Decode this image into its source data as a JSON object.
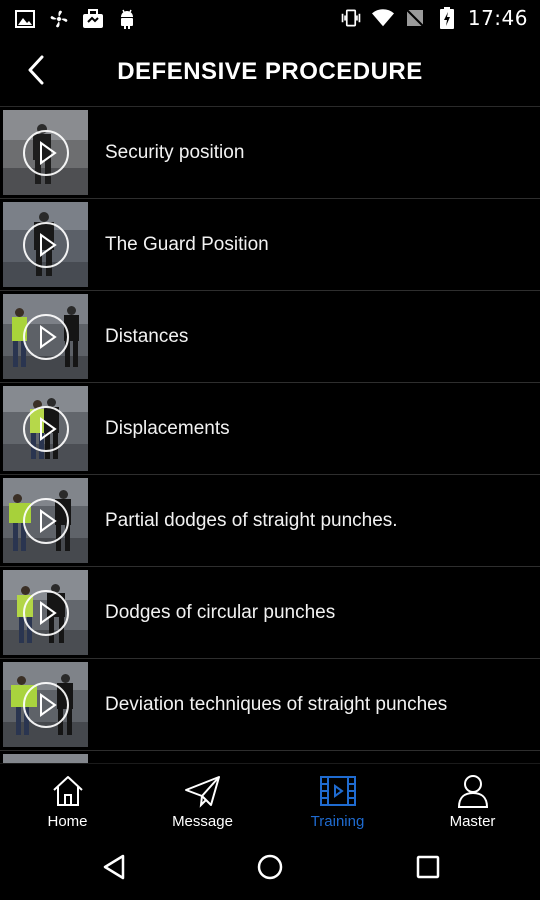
{
  "status_bar": {
    "time": "17:46",
    "left_icons": [
      "image-icon",
      "fan-icon",
      "briefcase-icon",
      "android-icon"
    ],
    "right_icons": [
      "vibrate-icon",
      "wifi-icon",
      "no-sim-icon",
      "battery-icon"
    ]
  },
  "header": {
    "title": "DEFENSIVE PROCEDURE",
    "back_icon": "chevron-left-icon"
  },
  "list": {
    "items": [
      {
        "label": "Security position"
      },
      {
        "label": "The Guard Position"
      },
      {
        "label": "Distances"
      },
      {
        "label": "Displacements"
      },
      {
        "label": "Partial dodges of straight punches."
      },
      {
        "label": "Dodges of circular punches"
      },
      {
        "label": "Deviation techniques of straight punches"
      }
    ]
  },
  "bottom_nav": {
    "items": [
      {
        "label": "Home",
        "icon": "house-icon"
      },
      {
        "label": "Message",
        "icon": "paper-plane-icon"
      },
      {
        "label": "Training",
        "icon": "film-icon",
        "active": true
      },
      {
        "label": "Master",
        "icon": "person-icon"
      }
    ]
  },
  "colors": {
    "background": "#000000",
    "active": "#1f6bd0",
    "divider": "#2e2e2e"
  },
  "system_nav": {
    "icons": [
      "back-triangle-icon",
      "home-circle-icon",
      "recents-square-icon"
    ]
  }
}
